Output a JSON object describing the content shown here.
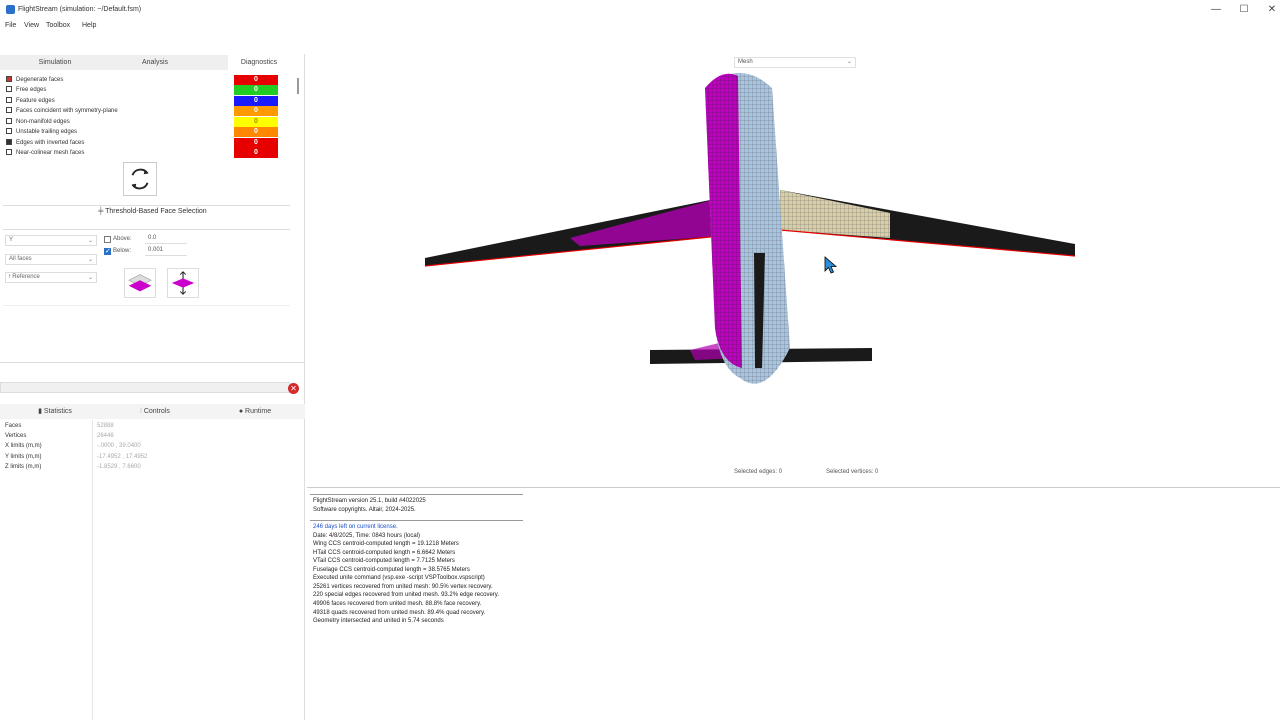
{
  "window": {
    "title": "FlightStream (simulation: ~/Default.fsm)",
    "minimize": "—",
    "maximize": "☐",
    "close": "✕"
  },
  "menu": [
    "File",
    "View",
    "Toolbox",
    "Help"
  ],
  "left_tabs": [
    "Simulation",
    "Analysis",
    "Diagnostics"
  ],
  "diagnostics": [
    {
      "label": "Degenerate faces",
      "count": "0",
      "color": "#e60000"
    },
    {
      "label": "Free edges",
      "count": "0",
      "color": "#22cc22"
    },
    {
      "label": "Feature edges",
      "count": "0",
      "color": "#1a1aff"
    },
    {
      "label": "Faces coincident with symmetry-plane",
      "count": "0",
      "color": "#ff9900"
    },
    {
      "label": "Non-manifold edges",
      "count": "0",
      "color": "#ffff00"
    },
    {
      "label": "Unstable trailing edges",
      "count": "0",
      "color": "#ff8800"
    },
    {
      "label": "Edges with inverted faces",
      "count": "0",
      "color": "#e60000"
    },
    {
      "label": "Near-colinear mesh faces",
      "count": "0",
      "color": "#e60000"
    }
  ],
  "threshold": {
    "title": "Threshold-Based Face Selection",
    "axis": "Y",
    "faces": "All faces",
    "frame": "Reference",
    "above_label": "Above:",
    "above_value": "0.0",
    "below_label": "Below:",
    "below_value": "0.001",
    "above_checked": false,
    "below_checked": true
  },
  "bottom_tabs": [
    "Statistics",
    "Controls",
    "Runtime"
  ],
  "statistics": [
    {
      "label": "Faces",
      "value": "52888"
    },
    {
      "label": "Vertices",
      "value": "26446"
    },
    {
      "label": "X limits (m,m)",
      "value": "-.0000 , 39.0400"
    },
    {
      "label": "Y limits (m,m)",
      "value": "-17.4952 , 17.4952"
    },
    {
      "label": "Z limits (m,m)",
      "value": "-1.8529 , 7.6600"
    }
  ],
  "viewport": {
    "mode": "Mesh",
    "selected_edges": "Selected edges: 0",
    "selected_vertices": "Selected vertices: 0"
  },
  "console": {
    "header": [
      "FlightStream version 25.1, build #4022025",
      "Software copyrights. Altair, 2024-2025."
    ],
    "lines": [
      {
        "text": "246 days left on current license.",
        "blue": true
      },
      {
        "text": "Date: 4/8/2025, Time: 0843 hours (local)",
        "blue": false
      },
      {
        "text": "Wing CCS centroid-computed length = 19.1218  Meters",
        "blue": false
      },
      {
        "text": "HTail CCS centroid-computed length = 6.6642  Meters",
        "blue": false
      },
      {
        "text": "VTail CCS centroid-computed length = 7.7125  Meters",
        "blue": false
      },
      {
        "text": "Fuselage CCS centroid-computed length = 38.5765  Meters",
        "blue": false
      },
      {
        "text": "Executed unite command (vsp.exe -script VSPToolbox.vspscript)",
        "blue": false
      },
      {
        "text": "25261 vertices recovered from united mesh: 90.5% vertex recovery.",
        "blue": false
      },
      {
        "text": "220 special edges recovered from united mesh. 93.2% edge recovery.",
        "blue": false
      },
      {
        "text": "49906 faces recovered from united mesh. 88.8% face recovery.",
        "blue": false
      },
      {
        "text": "49318 quads recovered from united mesh. 89.4% quad recovery.",
        "blue": false
      },
      {
        "text": "Geometry intersected and united in 5.74 seconds",
        "blue": false
      }
    ]
  },
  "colors": {
    "accent": "#2a6fc9",
    "magenta": "#cc00cc",
    "mesh_blue": "#a9c4dc"
  }
}
